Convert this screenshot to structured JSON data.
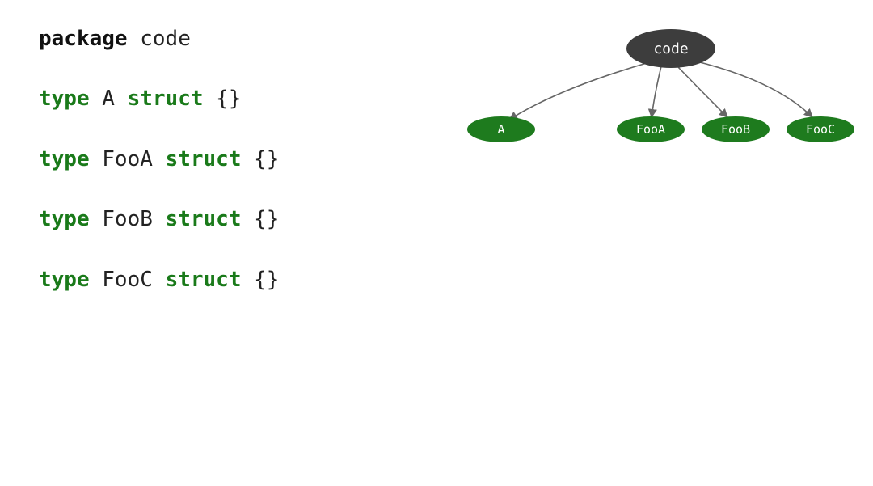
{
  "code": {
    "pkg_keyword": "package",
    "pkg_name": "code",
    "type_keyword": "type",
    "struct_keyword": "struct",
    "braces": "{}",
    "decls": [
      {
        "name": "A"
      },
      {
        "name": "FooA"
      },
      {
        "name": "FooB"
      },
      {
        "name": "FooC"
      }
    ]
  },
  "graph": {
    "root": {
      "label": "code",
      "fill": "#3d3d3d",
      "text": "#ffffff"
    },
    "children": [
      {
        "label": "A",
        "fill": "#1e7b1e",
        "text": "#ffffff"
      },
      {
        "label": "FooA",
        "fill": "#1e7b1e",
        "text": "#ffffff"
      },
      {
        "label": "FooB",
        "fill": "#1e7b1e",
        "text": "#ffffff"
      },
      {
        "label": "FooC",
        "fill": "#1e7b1e",
        "text": "#ffffff"
      }
    ],
    "edge_color": "#666666"
  }
}
